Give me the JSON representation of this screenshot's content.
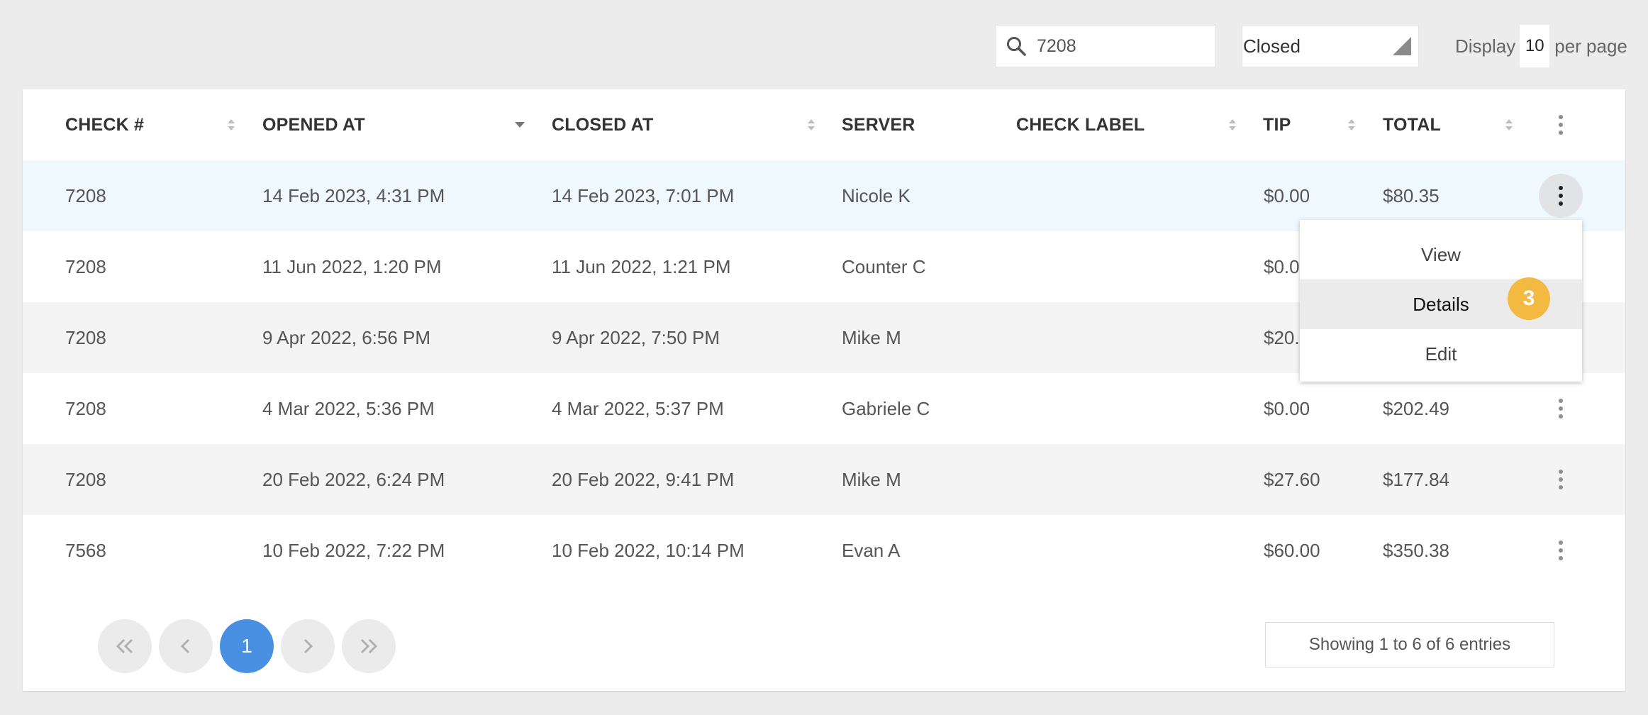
{
  "search": {
    "value": "7208"
  },
  "status_filter": {
    "selected": "Closed"
  },
  "display": {
    "prefix": "Display",
    "per_page": "10",
    "suffix": "per page"
  },
  "table": {
    "columns": [
      "CHECK #",
      "OPENED AT",
      "CLOSED AT",
      "SERVER",
      "CHECK LABEL",
      "TIP",
      "TOTAL"
    ],
    "rows": [
      {
        "check": "7208",
        "opened": "14 Feb 2023, 4:31 PM",
        "closed": "14 Feb 2023, 7:01 PM",
        "server": "Nicole K",
        "label": "",
        "tip": "$0.00",
        "total": "$80.35"
      },
      {
        "check": "7208",
        "opened": "11 Jun 2022, 1:20 PM",
        "closed": "11 Jun 2022, 1:21 PM",
        "server": "Counter C",
        "label": "",
        "tip": "$0.0",
        "total": ""
      },
      {
        "check": "7208",
        "opened": "9 Apr 2022, 6:56 PM",
        "closed": "9 Apr 2022, 7:50 PM",
        "server": "Mike M",
        "label": "",
        "tip": "$20.",
        "total": ""
      },
      {
        "check": "7208",
        "opened": "4 Mar 2022, 5:36 PM",
        "closed": "4 Mar 2022, 5:37 PM",
        "server": "Gabriele C",
        "label": "",
        "tip": "$0.00",
        "total": "$202.49"
      },
      {
        "check": "7208",
        "opened": "20 Feb 2022, 6:24 PM",
        "closed": "20 Feb 2022, 9:41 PM",
        "server": "Mike M",
        "label": "",
        "tip": "$27.60",
        "total": "$177.84"
      },
      {
        "check": "7568",
        "opened": "10 Feb 2022, 7:22 PM",
        "closed": "10 Feb 2022, 10:14 PM",
        "server": "Evan A",
        "label": "",
        "tip": "$60.00",
        "total": "$350.38"
      }
    ]
  },
  "row_menu": {
    "items": [
      "View",
      "Details",
      "Edit"
    ]
  },
  "step_badge": "3",
  "pagination": {
    "current": "1",
    "summary": "Showing 1 to 6 of 6 entries"
  },
  "colors": {
    "accent": "#4a90e2",
    "badge": "#f3b940",
    "row_highlight": "#eef8fd"
  }
}
